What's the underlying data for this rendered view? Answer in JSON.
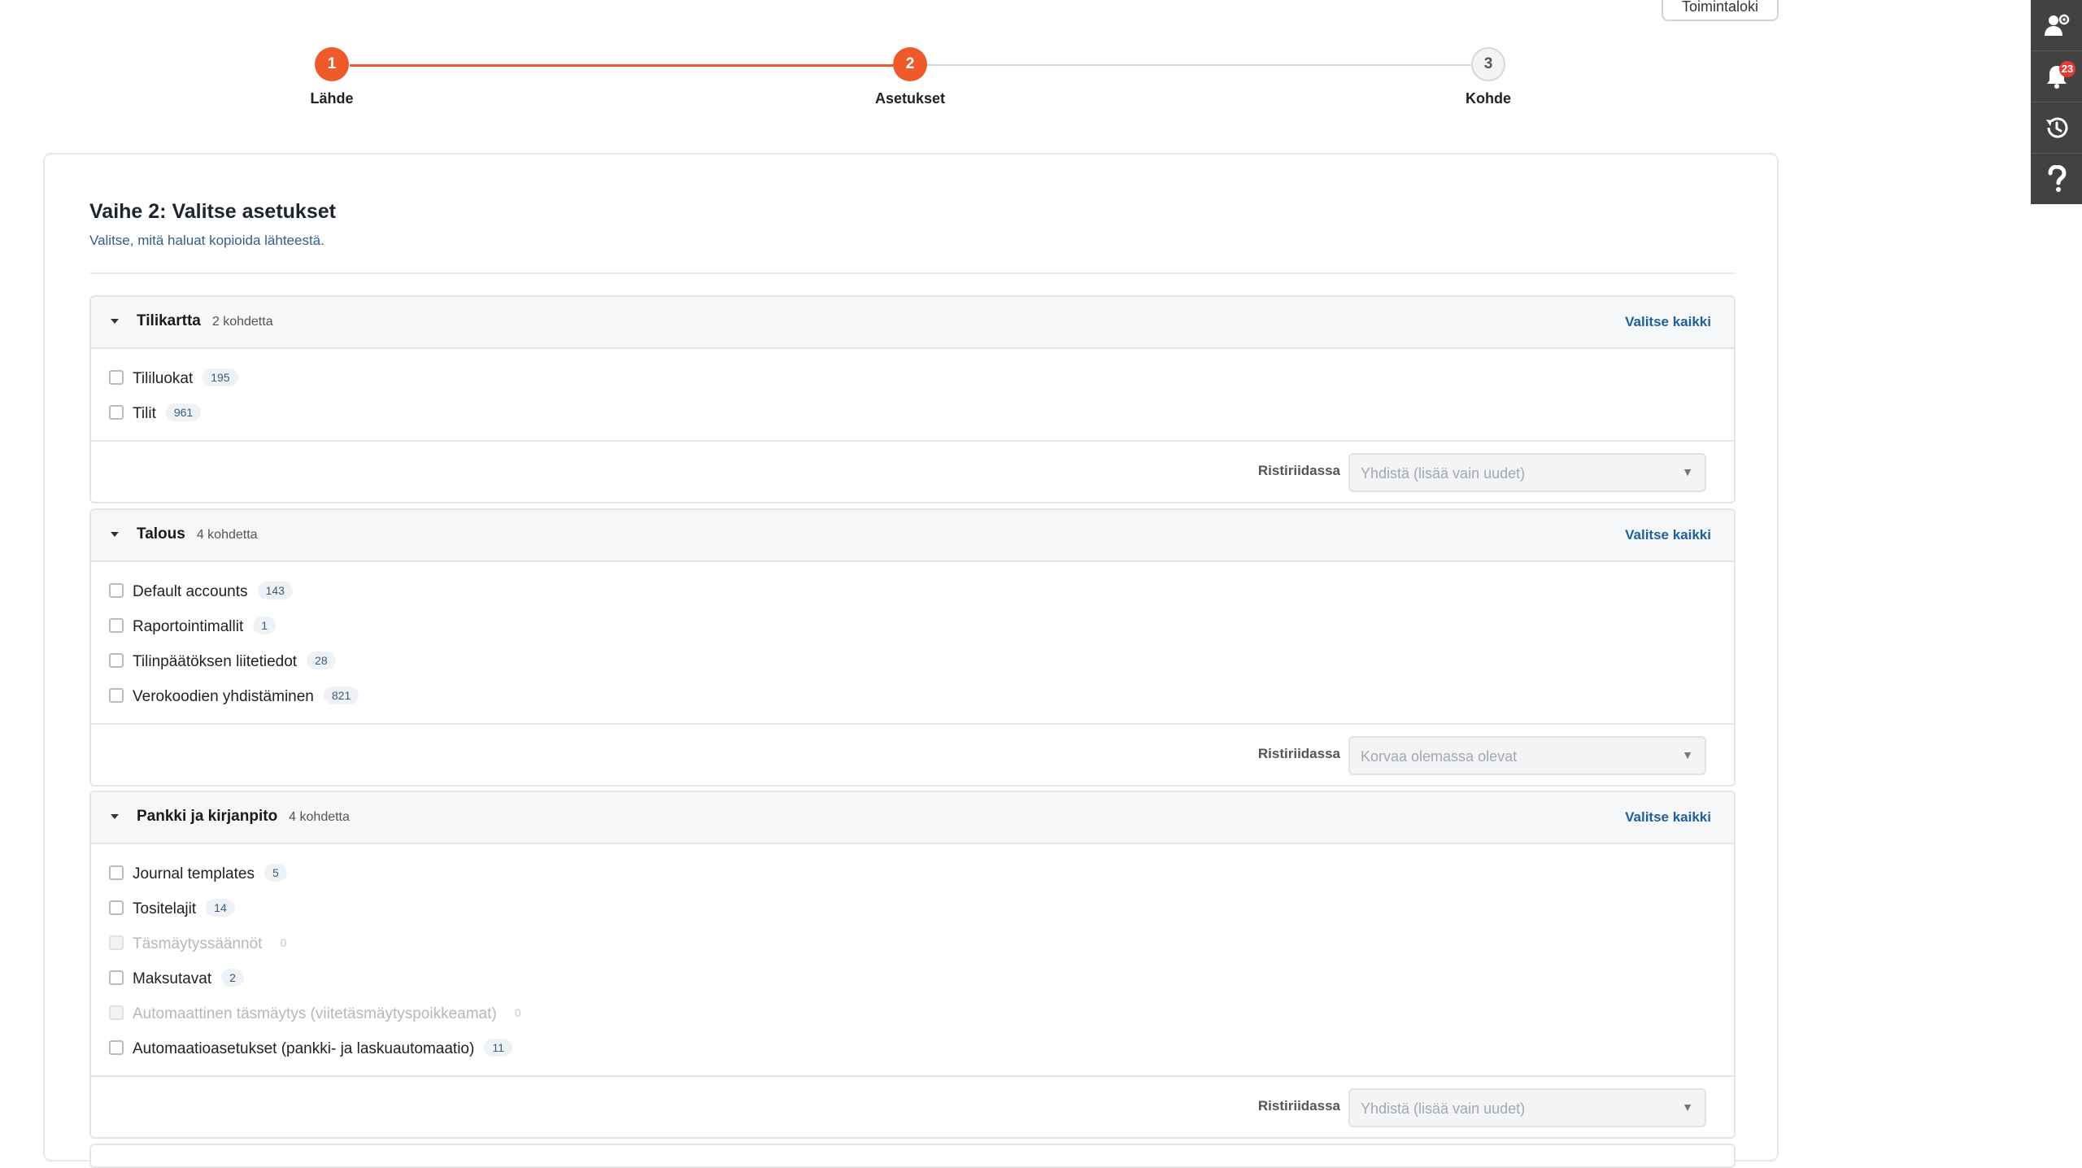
{
  "toolbar": {
    "log_button": "Toimintaloki"
  },
  "rail": {
    "notifications_badge": "23"
  },
  "stepper": {
    "steps": [
      {
        "number": "1",
        "label": "Lähde"
      },
      {
        "number": "2",
        "label": "Asetukset"
      },
      {
        "number": "3",
        "label": "Kohde"
      }
    ],
    "current_step": 2
  },
  "page": {
    "title": "Vaihe 2: Valitse asetukset",
    "subtitle": "Valitse, mitä haluat kopioida lähteestä."
  },
  "sections": [
    {
      "title": "Tilikartta",
      "count": "2 kohdetta",
      "select_all": "Valitse kaikki",
      "items": [
        {
          "label": "Tililuokat",
          "count": "195",
          "disabled": false
        },
        {
          "label": "Tilit",
          "count": "961",
          "disabled": false
        }
      ],
      "conflict_label": "Ristiriidassa",
      "conflict_value": "Yhdistä (lisää vain uudet)"
    },
    {
      "title": "Talous",
      "count": "4 kohdetta",
      "select_all": "Valitse kaikki",
      "items": [
        {
          "label": "Default accounts",
          "count": "143",
          "disabled": false
        },
        {
          "label": "Raportointimallit",
          "count": "1",
          "disabled": false
        },
        {
          "label": "Tilinpäätöksen liitetiedot",
          "count": "28",
          "disabled": false
        },
        {
          "label": "Verokoodien yhdistäminen",
          "count": "821",
          "disabled": false
        }
      ],
      "conflict_label": "Ristiriidassa",
      "conflict_value": "Korvaa olemassa olevat"
    },
    {
      "title": "Pankki ja kirjanpito",
      "count": "4 kohdetta",
      "select_all": "Valitse kaikki",
      "items": [
        {
          "label": "Journal templates",
          "count": "5",
          "disabled": false
        },
        {
          "label": "Tositelajit",
          "count": "14",
          "disabled": false
        },
        {
          "label": "Täsmäytyssäännöt",
          "count": "0",
          "disabled": true
        },
        {
          "label": "Maksutavat",
          "count": "2",
          "disabled": false
        },
        {
          "label": "Automaattinen täsmäytys (viitetäsmäytyspoikkeamat)",
          "count": "0",
          "disabled": true
        },
        {
          "label": "Automaatioasetukset (pankki- ja laskuautomaatio)",
          "count": "11",
          "disabled": false
        }
      ],
      "conflict_label": "Ristiriidassa",
      "conflict_value": "Yhdistä (lisää vain uudet)"
    }
  ],
  "colors": {
    "accent": "#ef5a2a",
    "link": "#1f5f9e",
    "rail": "#424242"
  }
}
